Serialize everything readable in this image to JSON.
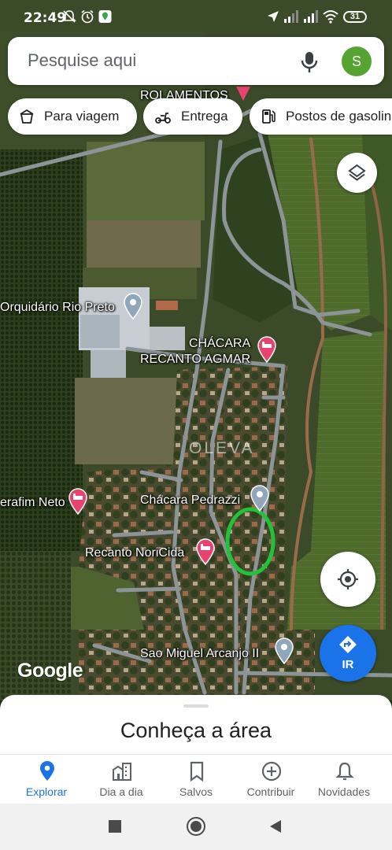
{
  "status_bar": {
    "time": "22:49",
    "battery": "31"
  },
  "search": {
    "placeholder": "Pesquise aqui",
    "avatar_letter": "S"
  },
  "chips": [
    {
      "label": "Para viagem",
      "icon": "takeout-icon"
    },
    {
      "label": "Entrega",
      "icon": "scooter-icon"
    },
    {
      "label": "Postos de gasolina",
      "icon": "gas-station-icon"
    }
  ],
  "map": {
    "labels": {
      "rolamentos": "ROLAMENTOS",
      "orquidario": "Orquidário Rio Preto",
      "chacara_recanto_line1": "CHÁCARA",
      "chacara_recanto_line2": "RECANTO AGMAR",
      "serafim": "erafim Neto",
      "pedrazzi": "Chácara Pedrazzi",
      "noricida": "Recanto NoriCida",
      "sao_miguel": "Sao Miguel Arcanjo II",
      "watermark": "OLEVA",
      "google": "Google"
    },
    "highlight_color": "#22c23b",
    "hotel_pin_color": "#e8436e",
    "place_pin_color": "#8fa7b8"
  },
  "go_button": {
    "label": "IR"
  },
  "bottom_sheet": {
    "title": "Conheça a área"
  },
  "nav": [
    {
      "label": "Explorar",
      "icon": "explore-pin-icon",
      "active": true
    },
    {
      "label": "Dia a dia",
      "icon": "city-icon"
    },
    {
      "label": "Salvos",
      "icon": "bookmark-icon"
    },
    {
      "label": "Contribuir",
      "icon": "add-circle-icon"
    },
    {
      "label": "Novidades",
      "icon": "bell-icon"
    }
  ],
  "colors": {
    "accent": "#1a73e8",
    "avatar": "#55a432"
  }
}
